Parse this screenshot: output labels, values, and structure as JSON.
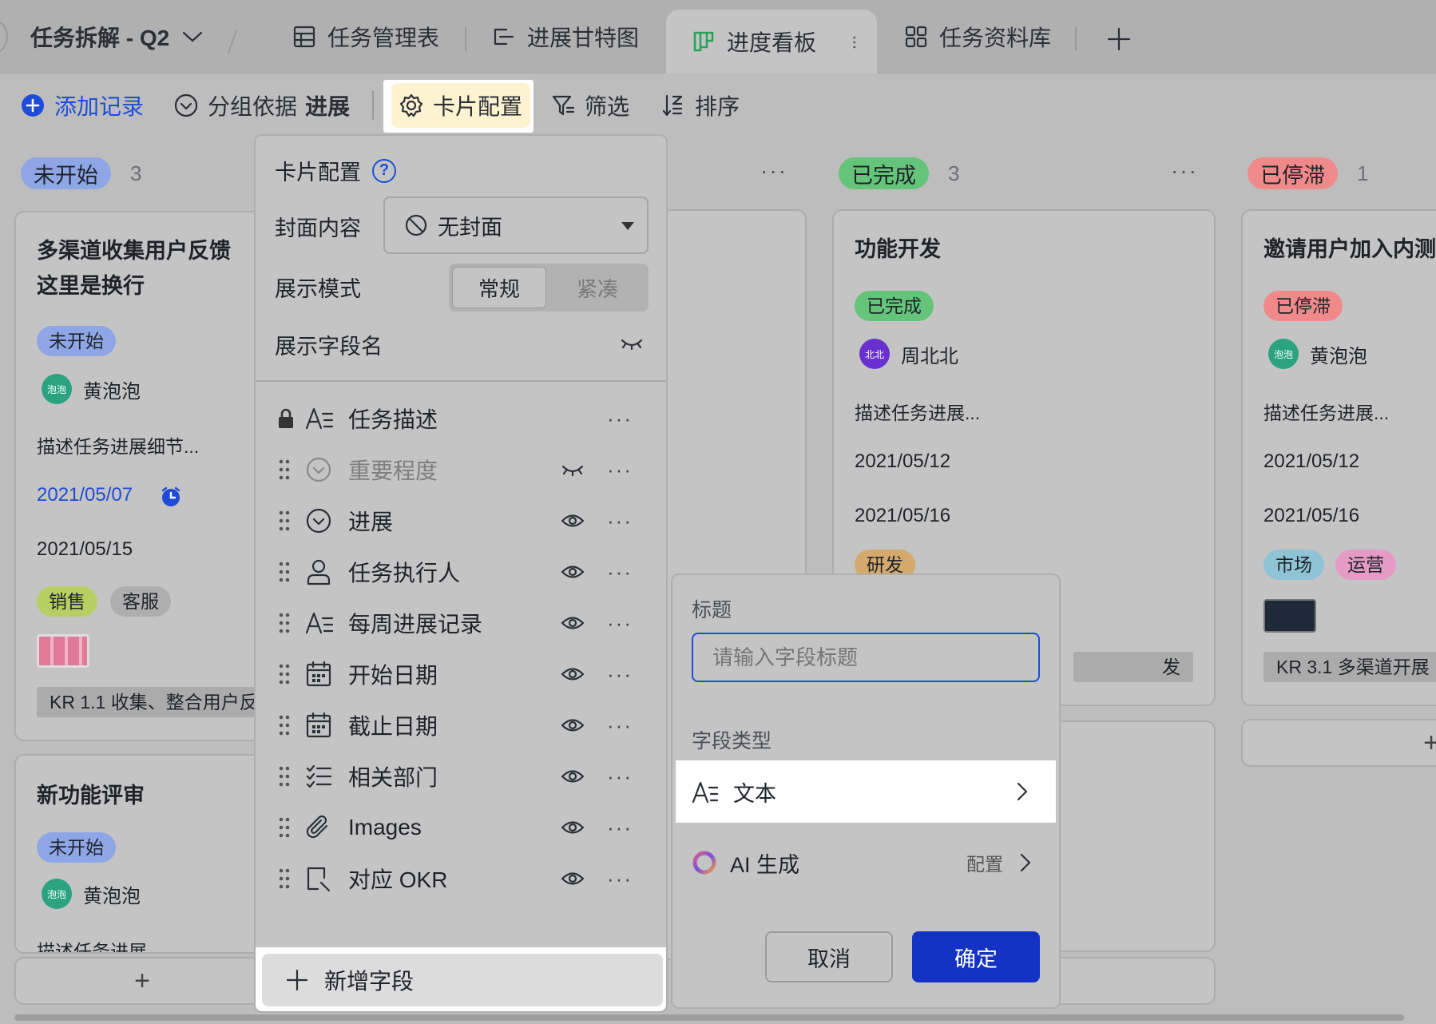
{
  "tabs": {
    "table_name": "任务拆解 - Q2",
    "items": [
      {
        "label": "任务管理表",
        "icon": "grid-table-icon"
      },
      {
        "label": "进展甘特图",
        "icon": "gantt-icon"
      },
      {
        "label": "进度看板",
        "icon": "kanban-icon",
        "active": true
      },
      {
        "label": "任务资料库",
        "icon": "gallery-icon"
      }
    ]
  },
  "toolbar": {
    "add_record": "添加记录",
    "group_by": "分组依据",
    "group_by_value": "进展",
    "card_config": "卡片配置",
    "filter": "筛选",
    "sort": "排序"
  },
  "board": {
    "columns": [
      {
        "name": "未开始",
        "count": "3",
        "color": "#8fa6e6"
      },
      {
        "name": "已完成",
        "count": "3",
        "color": "#64c47a"
      },
      {
        "name": "已停滞",
        "count": "1",
        "color": "#f08a8a"
      }
    ],
    "card1": {
      "title_line1": "多渠道收集用户反馈",
      "title_line2": "这里是换行",
      "status": "未开始",
      "assignee": "黄泡泡",
      "avatar_text": "泡泡",
      "desc": "描述任务进展细节...",
      "start_date": "2021/05/07",
      "end_date": "2021/05/15",
      "tags": [
        "销售",
        "客服"
      ],
      "okr": "KR 1.1 收集、整合用户反"
    },
    "card2": {
      "title": "新功能评审",
      "status": "未开始",
      "assignee": "黄泡泡",
      "avatar_text": "泡泡",
      "desc": "描述任务进展"
    },
    "card3": {
      "title": "功能开发",
      "status": "已完成",
      "assignee": "周北北",
      "avatar_text": "北北",
      "desc": "描述任务进展...",
      "start_date": "2021/05/12",
      "end_date": "2021/05/16",
      "tag": "研发",
      "okr_tail": "发"
    },
    "card4": {
      "title": "邀请用户加入内测",
      "status": "已停滞",
      "assignee": "黄泡泡",
      "avatar_text": "泡泡",
      "desc": "描述任务进展...",
      "start_date": "2021/05/12",
      "end_date": "2021/05/16",
      "tags": [
        "市场",
        "运营"
      ],
      "okr": "KR 3.1 多渠道开展"
    },
    "add_symbol": "+",
    "more_symbol": "···"
  },
  "card_config_panel": {
    "title": "卡片配置",
    "help": "?",
    "cover_label": "封面内容",
    "cover_value": "无封面",
    "mode_label": "展示模式",
    "mode_options": [
      "常规",
      "紧凑"
    ],
    "show_field_name_label": "展示字段名",
    "fields": [
      {
        "name": "任务描述",
        "icon": "text-field-icon",
        "locked": true
      },
      {
        "name": "重要程度",
        "icon": "single-select-icon",
        "hidden": true
      },
      {
        "name": "进展",
        "icon": "single-select-icon"
      },
      {
        "name": "任务执行人",
        "icon": "person-icon"
      },
      {
        "name": "每周进展记录",
        "icon": "text-field-icon"
      },
      {
        "name": "开始日期",
        "icon": "calendar-icon"
      },
      {
        "name": "截止日期",
        "icon": "calendar-icon"
      },
      {
        "name": "相关部门",
        "icon": "multi-select-icon"
      },
      {
        "name": "Images",
        "icon": "attachment-icon"
      },
      {
        "name": "对应 OKR",
        "icon": "link-icon"
      }
    ],
    "add_field": "新增字段"
  },
  "new_field_popup": {
    "title_label": "标题",
    "title_placeholder": "请输入字段标题",
    "type_label": "字段类型",
    "type_value": "文本",
    "ai_label": "AI 生成",
    "ai_config": "配置",
    "cancel": "取消",
    "confirm": "确定"
  }
}
